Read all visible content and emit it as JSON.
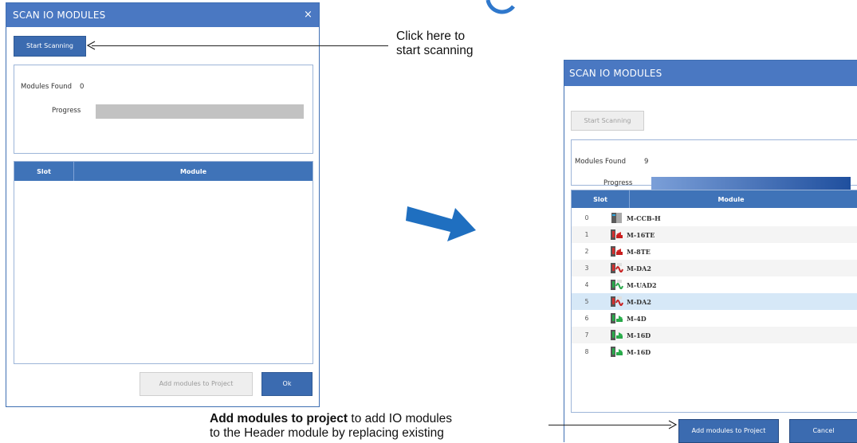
{
  "left_dialog": {
    "title": "SCAN IO MODULES",
    "close_glyph": "×",
    "start_button": "Start Scanning",
    "modules_found_label": "Modules Found",
    "modules_found_value": "0",
    "progress_label": "Progress",
    "progress_fraction": 0,
    "columns": [
      "Slot",
      "Module"
    ],
    "add_button": "Add modules to Project",
    "ok_button": "Ok"
  },
  "right_dialog": {
    "title": "SCAN IO MODULES",
    "start_button": "Start Scanning",
    "modules_found_label": "Modules Found",
    "modules_found_value": "9",
    "progress_label": "Progress",
    "progress_fraction": 1,
    "columns": [
      "Slot",
      "Module"
    ],
    "rows": [
      {
        "slot": "0",
        "module": "M-CCB-H",
        "icon": "header-module-icon",
        "selected": false
      },
      {
        "slot": "1",
        "module": "M-16TE",
        "icon": "output-module-icon",
        "selected": false
      },
      {
        "slot": "2",
        "module": "M-8TE",
        "icon": "output-module-icon",
        "selected": false
      },
      {
        "slot": "3",
        "module": "M-DA2",
        "icon": "analog-output-module-icon",
        "selected": false
      },
      {
        "slot": "4",
        "module": "M-UAD2",
        "icon": "analog-input-module-icon",
        "selected": false
      },
      {
        "slot": "5",
        "module": "M-DA2",
        "icon": "analog-output-module-icon",
        "selected": true
      },
      {
        "slot": "6",
        "module": "M-4D",
        "icon": "input-module-icon",
        "selected": false
      },
      {
        "slot": "7",
        "module": "M-16D",
        "icon": "input-module-icon",
        "selected": false
      },
      {
        "slot": "8",
        "module": "M-16D",
        "icon": "input-module-icon",
        "selected": false
      }
    ],
    "add_button": "Add modules to Project",
    "cancel_button": "Cancel"
  },
  "callouts": {
    "start_line1": "Click here to",
    "start_line2": "start scanning",
    "add_bold": "Add modules to project",
    "add_rest": " to add IO modules",
    "add_line2": "to the Header module by replacing existing"
  },
  "colors": {
    "title_bar": "#4a78c2",
    "table_header": "#3f73b8",
    "primary_button": "#3b6bb0",
    "big_arrow": "#1f6fc0",
    "selected_row": "#d6e8f7"
  }
}
